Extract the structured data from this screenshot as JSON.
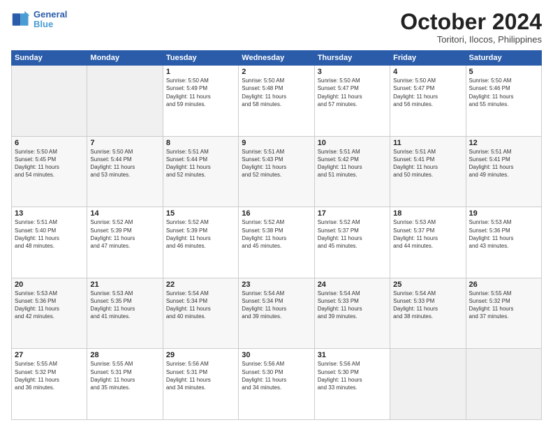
{
  "header": {
    "logo_line1": "General",
    "logo_line2": "Blue",
    "month": "October 2024",
    "location": "Toritori, Ilocos, Philippines"
  },
  "weekdays": [
    "Sunday",
    "Monday",
    "Tuesday",
    "Wednesday",
    "Thursday",
    "Friday",
    "Saturday"
  ],
  "weeks": [
    [
      {
        "day": "",
        "info": ""
      },
      {
        "day": "",
        "info": ""
      },
      {
        "day": "1",
        "info": "Sunrise: 5:50 AM\nSunset: 5:49 PM\nDaylight: 11 hours\nand 59 minutes."
      },
      {
        "day": "2",
        "info": "Sunrise: 5:50 AM\nSunset: 5:48 PM\nDaylight: 11 hours\nand 58 minutes."
      },
      {
        "day": "3",
        "info": "Sunrise: 5:50 AM\nSunset: 5:47 PM\nDaylight: 11 hours\nand 57 minutes."
      },
      {
        "day": "4",
        "info": "Sunrise: 5:50 AM\nSunset: 5:47 PM\nDaylight: 11 hours\nand 56 minutes."
      },
      {
        "day": "5",
        "info": "Sunrise: 5:50 AM\nSunset: 5:46 PM\nDaylight: 11 hours\nand 55 minutes."
      }
    ],
    [
      {
        "day": "6",
        "info": "Sunrise: 5:50 AM\nSunset: 5:45 PM\nDaylight: 11 hours\nand 54 minutes."
      },
      {
        "day": "7",
        "info": "Sunrise: 5:50 AM\nSunset: 5:44 PM\nDaylight: 11 hours\nand 53 minutes."
      },
      {
        "day": "8",
        "info": "Sunrise: 5:51 AM\nSunset: 5:44 PM\nDaylight: 11 hours\nand 52 minutes."
      },
      {
        "day": "9",
        "info": "Sunrise: 5:51 AM\nSunset: 5:43 PM\nDaylight: 11 hours\nand 52 minutes."
      },
      {
        "day": "10",
        "info": "Sunrise: 5:51 AM\nSunset: 5:42 PM\nDaylight: 11 hours\nand 51 minutes."
      },
      {
        "day": "11",
        "info": "Sunrise: 5:51 AM\nSunset: 5:41 PM\nDaylight: 11 hours\nand 50 minutes."
      },
      {
        "day": "12",
        "info": "Sunrise: 5:51 AM\nSunset: 5:41 PM\nDaylight: 11 hours\nand 49 minutes."
      }
    ],
    [
      {
        "day": "13",
        "info": "Sunrise: 5:51 AM\nSunset: 5:40 PM\nDaylight: 11 hours\nand 48 minutes."
      },
      {
        "day": "14",
        "info": "Sunrise: 5:52 AM\nSunset: 5:39 PM\nDaylight: 11 hours\nand 47 minutes."
      },
      {
        "day": "15",
        "info": "Sunrise: 5:52 AM\nSunset: 5:39 PM\nDaylight: 11 hours\nand 46 minutes."
      },
      {
        "day": "16",
        "info": "Sunrise: 5:52 AM\nSunset: 5:38 PM\nDaylight: 11 hours\nand 45 minutes."
      },
      {
        "day": "17",
        "info": "Sunrise: 5:52 AM\nSunset: 5:37 PM\nDaylight: 11 hours\nand 45 minutes."
      },
      {
        "day": "18",
        "info": "Sunrise: 5:53 AM\nSunset: 5:37 PM\nDaylight: 11 hours\nand 44 minutes."
      },
      {
        "day": "19",
        "info": "Sunrise: 5:53 AM\nSunset: 5:36 PM\nDaylight: 11 hours\nand 43 minutes."
      }
    ],
    [
      {
        "day": "20",
        "info": "Sunrise: 5:53 AM\nSunset: 5:36 PM\nDaylight: 11 hours\nand 42 minutes."
      },
      {
        "day": "21",
        "info": "Sunrise: 5:53 AM\nSunset: 5:35 PM\nDaylight: 11 hours\nand 41 minutes."
      },
      {
        "day": "22",
        "info": "Sunrise: 5:54 AM\nSunset: 5:34 PM\nDaylight: 11 hours\nand 40 minutes."
      },
      {
        "day": "23",
        "info": "Sunrise: 5:54 AM\nSunset: 5:34 PM\nDaylight: 11 hours\nand 39 minutes."
      },
      {
        "day": "24",
        "info": "Sunrise: 5:54 AM\nSunset: 5:33 PM\nDaylight: 11 hours\nand 39 minutes."
      },
      {
        "day": "25",
        "info": "Sunrise: 5:54 AM\nSunset: 5:33 PM\nDaylight: 11 hours\nand 38 minutes."
      },
      {
        "day": "26",
        "info": "Sunrise: 5:55 AM\nSunset: 5:32 PM\nDaylight: 11 hours\nand 37 minutes."
      }
    ],
    [
      {
        "day": "27",
        "info": "Sunrise: 5:55 AM\nSunset: 5:32 PM\nDaylight: 11 hours\nand 36 minutes."
      },
      {
        "day": "28",
        "info": "Sunrise: 5:55 AM\nSunset: 5:31 PM\nDaylight: 11 hours\nand 35 minutes."
      },
      {
        "day": "29",
        "info": "Sunrise: 5:56 AM\nSunset: 5:31 PM\nDaylight: 11 hours\nand 34 minutes."
      },
      {
        "day": "30",
        "info": "Sunrise: 5:56 AM\nSunset: 5:30 PM\nDaylight: 11 hours\nand 34 minutes."
      },
      {
        "day": "31",
        "info": "Sunrise: 5:56 AM\nSunset: 5:30 PM\nDaylight: 11 hours\nand 33 minutes."
      },
      {
        "day": "",
        "info": ""
      },
      {
        "day": "",
        "info": ""
      }
    ]
  ]
}
